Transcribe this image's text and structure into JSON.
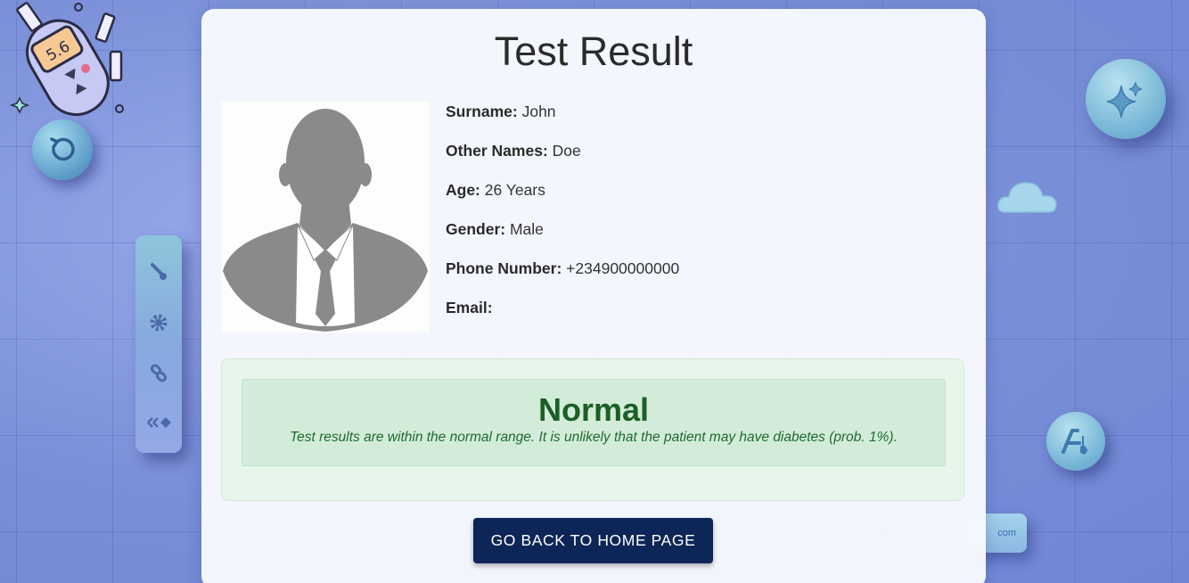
{
  "page": {
    "title": "Test Result"
  },
  "patient": {
    "fields": [
      {
        "label": "Surname:",
        "value": "John"
      },
      {
        "label": "Other Names:",
        "value": "Doe"
      },
      {
        "label": "Age:",
        "value": "26 Years"
      },
      {
        "label": "Gender:",
        "value": "Male"
      },
      {
        "label": "Phone Number:",
        "value": "+234900000000"
      },
      {
        "label": "Email:",
        "value": ""
      }
    ]
  },
  "result": {
    "status": "Normal",
    "description": "Test results are within the normal range. It is unlikely that the patient may have diabetes (prob. 1%).",
    "status_color": "#1c5e28",
    "box_color": "#d3ecd9"
  },
  "actions": {
    "home_label": "GO BACK TO HOME PAGE"
  },
  "background": {
    "glucometer_reading": "5.6",
    "url_chip_text": "com",
    "icons": [
      "glucometer-icon",
      "refresh-icon",
      "brush-icon",
      "gear-icon",
      "link-icon",
      "diamond-icon",
      "sparkle-icon",
      "cloud-icon",
      "ai-icon"
    ]
  },
  "colors": {
    "button_bg": "#0d2657",
    "card_bg": "#f7f9fd",
    "page_bg": "#7e93da"
  }
}
